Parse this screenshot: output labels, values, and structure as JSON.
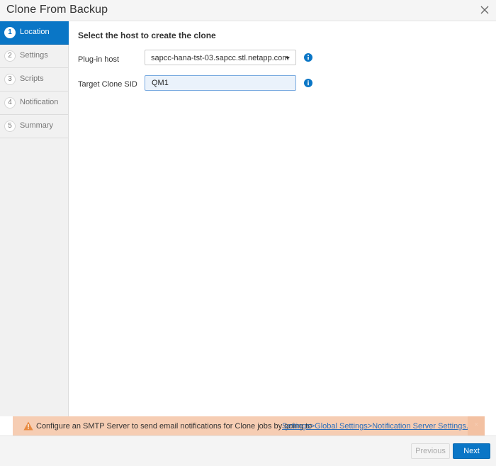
{
  "dialog": {
    "title": "Clone From Backup"
  },
  "sidebar": {
    "steps": [
      {
        "number": "1",
        "label": "Location",
        "active": true
      },
      {
        "number": "2",
        "label": "Settings",
        "active": false
      },
      {
        "number": "3",
        "label": "Scripts",
        "active": false
      },
      {
        "number": "4",
        "label": "Notification",
        "active": false
      },
      {
        "number": "5",
        "label": "Summary",
        "active": false
      }
    ]
  },
  "main": {
    "heading": "Select the host to create the clone",
    "plugin_host": {
      "label": "Plug-in host",
      "value": "sapcc-hana-tst-03.sapcc.stl.netapp.com"
    },
    "target_sid": {
      "label": "Target Clone SID",
      "value": "QM1"
    }
  },
  "banner": {
    "message": "Configure an SMTP Server to send email notifications for Clone jobs by going to",
    "link": "Settings>Global Settings>Notification Server Settings.",
    "dismiss": "×"
  },
  "footer": {
    "previous": "Previous",
    "next": "Next"
  },
  "colors": {
    "accent": "#0a76c6",
    "banner_bg": "#f6cdb3",
    "warning": "#e8893f",
    "info": "#0a76c6"
  }
}
